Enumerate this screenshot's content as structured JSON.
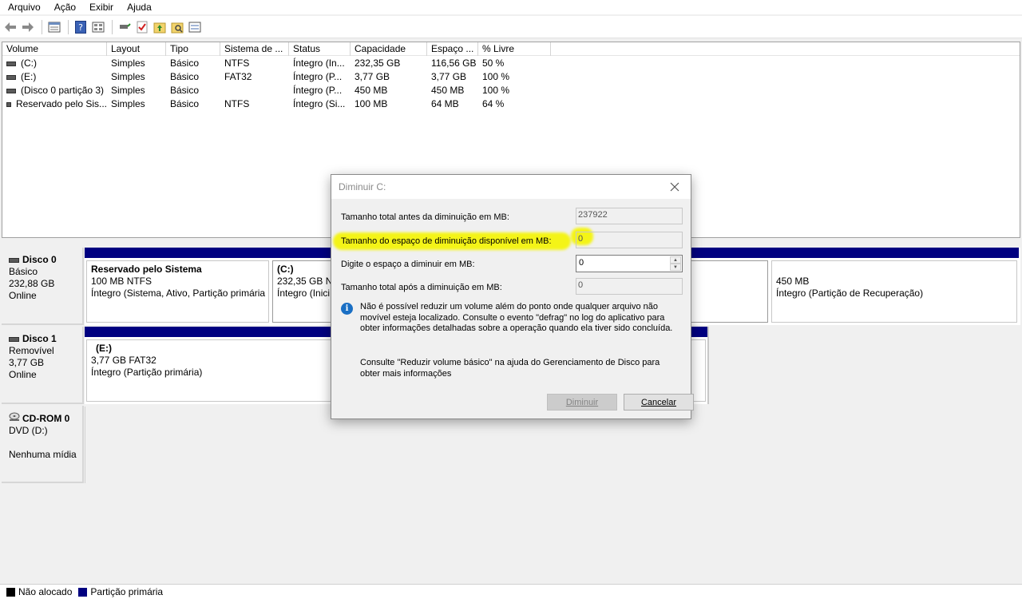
{
  "menu": [
    "Arquivo",
    "Ação",
    "Exibir",
    "Ajuda"
  ],
  "volume_table": {
    "columns": [
      "Volume",
      "Layout",
      "Tipo",
      "Sistema de ...",
      "Status",
      "Capacidade",
      "Espaço ...",
      "% Livre"
    ],
    "rows": [
      [
        "(C:)",
        "Simples",
        "Básico",
        "NTFS",
        "Íntegro (In...",
        "232,35 GB",
        "116,56 GB",
        "50 %"
      ],
      [
        "(E:)",
        "Simples",
        "Básico",
        "FAT32",
        "Íntegro (P...",
        "3,77 GB",
        "3,77 GB",
        "100 %"
      ],
      [
        "(Disco 0 partição 3)",
        "Simples",
        "Básico",
        "",
        "Íntegro (P...",
        "450 MB",
        "450 MB",
        "100 %"
      ],
      [
        "Reservado pelo Sis...",
        "Simples",
        "Básico",
        "NTFS",
        "Íntegro (Si...",
        "100 MB",
        "64 MB",
        "64 %"
      ]
    ]
  },
  "disks": {
    "disk0": {
      "name": "Disco 0",
      "type": "Básico",
      "size": "232,88 GB",
      "status": "Online",
      "partitions": [
        {
          "title": "Reservado pelo Sistema",
          "detail": "100 MB NTFS",
          "status": "Íntegro (Sistema, Ativo, Partição primária"
        },
        {
          "title": "(C:)",
          "detail": "232,35 GB NT",
          "status": "Íntegro (Inici"
        },
        {
          "title": "",
          "detail": "450 MB",
          "status": "Íntegro (Partição de Recuperação)"
        }
      ]
    },
    "disk1": {
      "name": "Disco 1",
      "type": "Removível",
      "size": "3,77 GB",
      "status": "Online",
      "partitions": [
        {
          "title": "(E:)",
          "detail": "3,77 GB FAT32",
          "status": "Íntegro (Partição primária)"
        }
      ]
    },
    "cdrom": {
      "name": "CD-ROM 0",
      "type": "DVD (D:)",
      "status": "Nenhuma mídia"
    }
  },
  "legend": {
    "unallocated": "Não alocado",
    "primary": "Partição primária",
    "unallocated_color": "#000000",
    "primary_color": "#000080"
  },
  "dialog": {
    "title": "Diminuir C:",
    "total_before_label": "Tamanho total antes da diminuição em MB:",
    "total_before_value": "237922",
    "available_label": "Tamanho do espaço de diminuição disponível em MB:",
    "available_value": "0",
    "enter_label": "Digite o espaço a diminuir em MB:",
    "enter_value": "0",
    "total_after_label": "Tamanho total após a diminuição em MB:",
    "total_after_value": "0",
    "info_text": "Não é possível reduzir um volume além do ponto onde qualquer arquivo não movível esteja localizado. Consulte o evento \"defrag\" no log do aplicativo para obter informações detalhadas sobre a operação quando ela tiver sido concluída.",
    "help_text": "Consulte \"Reduzir volume básico\" na ajuda do Gerenciamento de Disco para obter mais informações",
    "shrink_button": "Diminuir",
    "cancel_button": "Cancelar"
  }
}
